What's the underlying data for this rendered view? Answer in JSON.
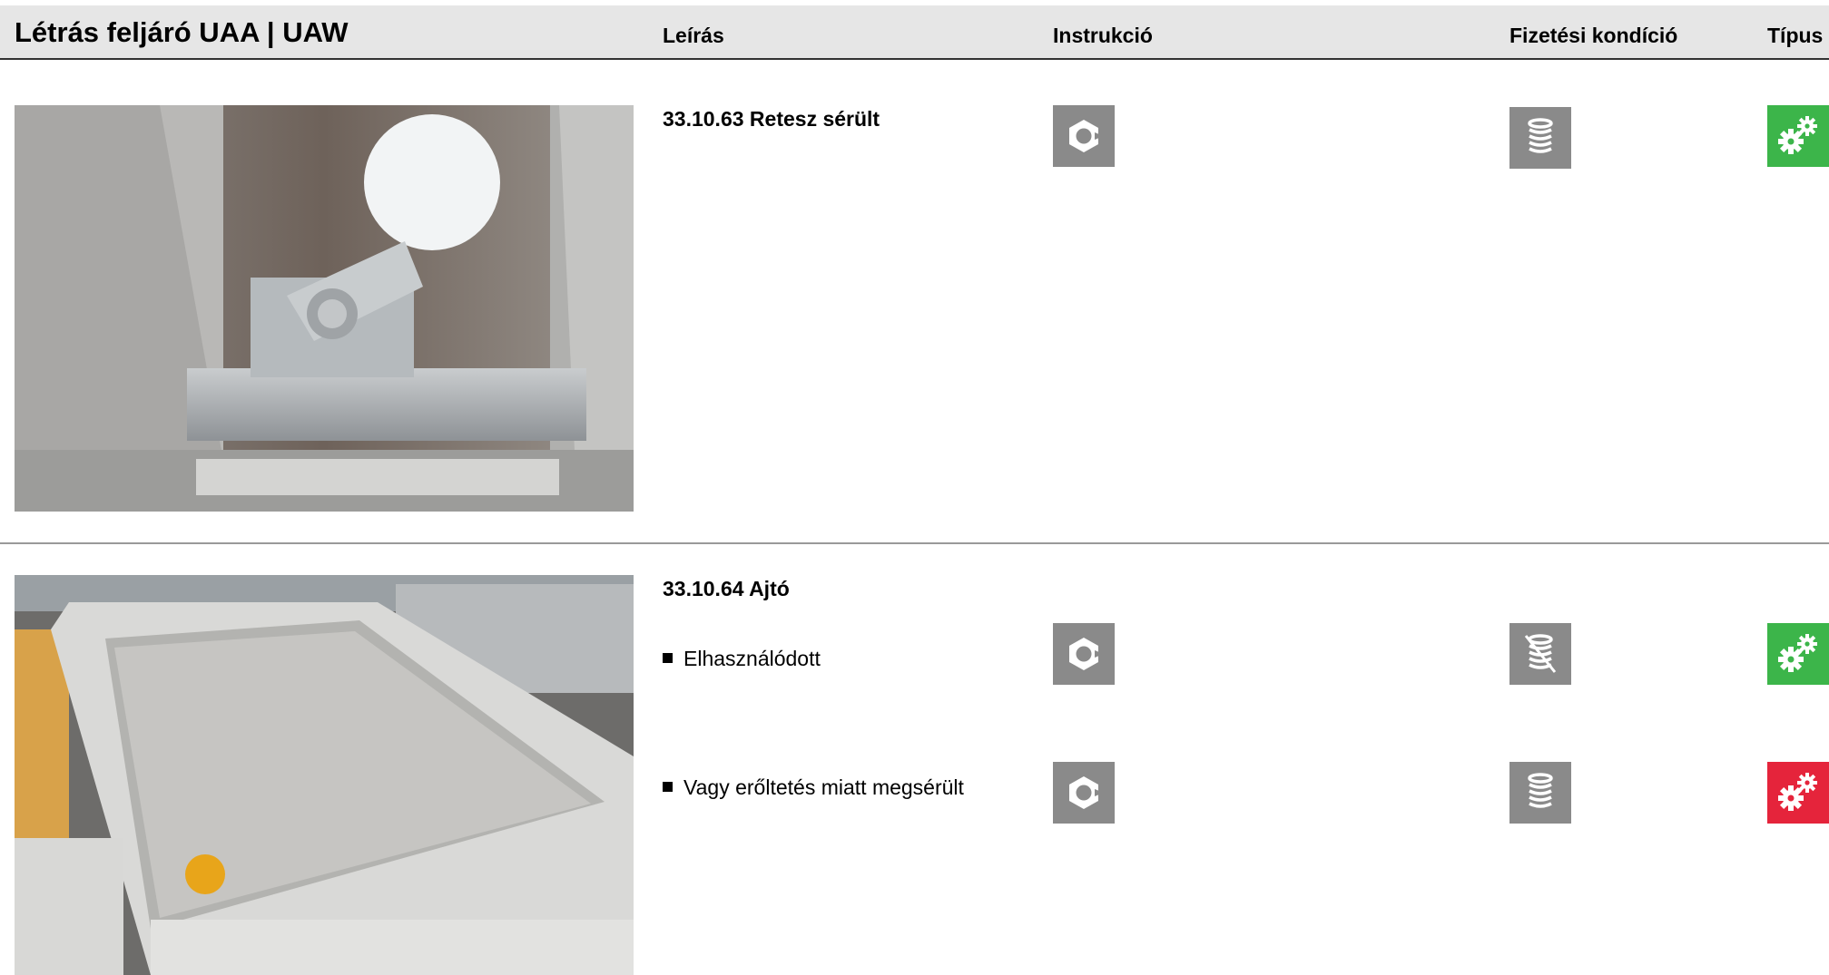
{
  "header": {
    "title": "Létrás feljáró UAA | UAW",
    "columns": {
      "leiras": "Leírás",
      "instrukcio": "Instrukció",
      "fizetesi": "Fizetési kondíció",
      "tipus": "Típus"
    }
  },
  "items": [
    {
      "title": "33.10.63 Retesz sérült",
      "photo": "latch-photo",
      "rows": [
        {
          "label": "",
          "instruction_icon": "nut-icon",
          "payment_icon": "coins-stack-icon",
          "type_icon": "gears-icon",
          "type_color": "#3cb54a"
        }
      ]
    },
    {
      "title": "33.10.64 Ajtó",
      "photo": "hatch-door-photo",
      "rows": [
        {
          "label": "Elhasználódott",
          "instruction_icon": "nut-icon",
          "payment_icon": "coins-stack-crossed-icon",
          "type_icon": "gears-icon",
          "type_color": "#3cb54a"
        },
        {
          "label": "Vagy erőltetés miatt megsérült",
          "instruction_icon": "nut-icon",
          "payment_icon": "coins-stack-icon",
          "type_icon": "gears-icon",
          "type_color": "#e5243b"
        }
      ]
    }
  ],
  "colors": {
    "header_bg": "#e6e6e6",
    "icon_grey": "#8a8a8a",
    "type_green": "#3cb54a",
    "type_red": "#e5243b"
  }
}
